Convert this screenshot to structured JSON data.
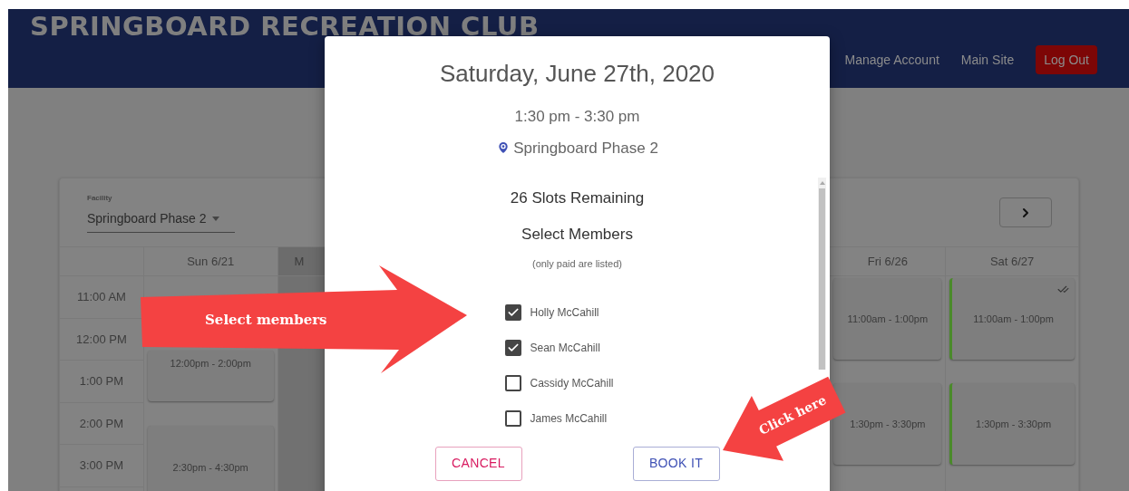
{
  "header": {
    "title": "SPRINGBOARD RECREATION CLUB",
    "nav": [
      {
        "label": "Manage Account",
        "kind": "link"
      },
      {
        "label": "Main Site",
        "kind": "link"
      },
      {
        "label": "Log Out",
        "kind": "button"
      }
    ]
  },
  "calendar": {
    "facility_label": "Facility",
    "facility": "Springboard Phase 2",
    "times": [
      "11:00 AM",
      "12:00 PM",
      "1:00 PM",
      "2:00 PM",
      "3:00 PM"
    ],
    "days": [
      {
        "label": "Sun 6/21",
        "shaded": false,
        "events": [
          {
            "time": "12:00pm - 2:00pm",
            "highlighted": false,
            "checked": false
          },
          {
            "time": "2:30pm - 4:30pm",
            "highlighted": false,
            "checked": false
          }
        ]
      },
      {
        "label": "M",
        "shaded": true
      },
      {
        "label": "Fri 6/26",
        "shaded": false,
        "events": [
          {
            "time": "11:00am - 1:00pm",
            "highlighted": false,
            "checked": false
          },
          {
            "time": "1:30pm - 3:30pm",
            "highlighted": false,
            "checked": false
          }
        ]
      },
      {
        "label": "Sat 6/27",
        "shaded": false,
        "events": [
          {
            "time": "11:00am - 1:00pm",
            "highlighted": true,
            "checked": true
          },
          {
            "time": "1:30pm - 3:30pm",
            "highlighted": true,
            "checked": false
          }
        ]
      }
    ]
  },
  "modal": {
    "title": "Saturday, June 27th, 2020",
    "time": "1:30 pm - 3:30 pm",
    "location": "Springboard Phase 2",
    "slots": "26 Slots Remaining",
    "heading": "Select Members",
    "note": "(only paid are listed)",
    "members": [
      {
        "name": "Holly McCahill",
        "checked": true
      },
      {
        "name": "Sean McCahill",
        "checked": true
      },
      {
        "name": "Cassidy McCahill",
        "checked": false
      },
      {
        "name": "James McCahill",
        "checked": false
      }
    ],
    "buttons": [
      {
        "label": "CANCEL",
        "kind": "cancel"
      },
      {
        "label": "BOOK IT",
        "kind": "confirm"
      }
    ]
  },
  "annotations": [
    {
      "text": "Select members",
      "kind": "right"
    },
    {
      "text": "Click here",
      "kind": "down-left"
    }
  ]
}
